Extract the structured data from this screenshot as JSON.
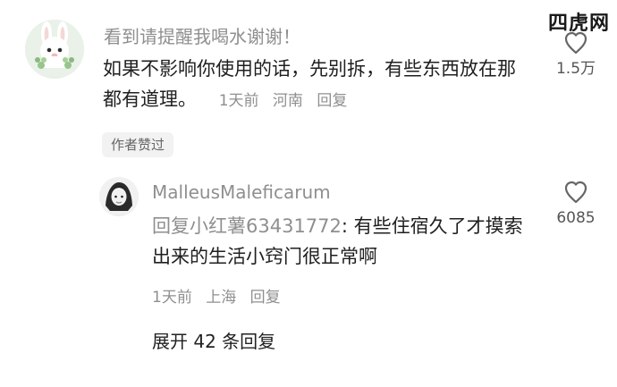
{
  "watermark": {
    "text": "四虎网"
  },
  "colors": {
    "secondary_text": "#8f8f8f",
    "badge_background": "#f2f2f2",
    "body_text": "#1f1f1f"
  },
  "comment": {
    "avatar_icon": "bunny-avatar-icon",
    "username": "看到请提醒我喝水谢谢！",
    "text": "如果不影响你使用的话，先别拆，有些东西放在那都有道理。",
    "meta": {
      "time": "1天前",
      "location": "河南",
      "reply_label": "回复"
    },
    "badge": "作者赞过",
    "like_count": "1.5万"
  },
  "reply": {
    "avatar_icon": "portrait-avatar-icon",
    "username": "MalleusMaleficarum",
    "prefix": "回复",
    "target": "小红薯63431772",
    "text": ": 有些住宿久了才摸索出来的生活小窍门很正常啊",
    "meta": {
      "time": "1天前",
      "location": "上海",
      "reply_label": "回复"
    },
    "like_count": "6085"
  },
  "thread": {
    "expand_label": "展开 42 条回复"
  }
}
